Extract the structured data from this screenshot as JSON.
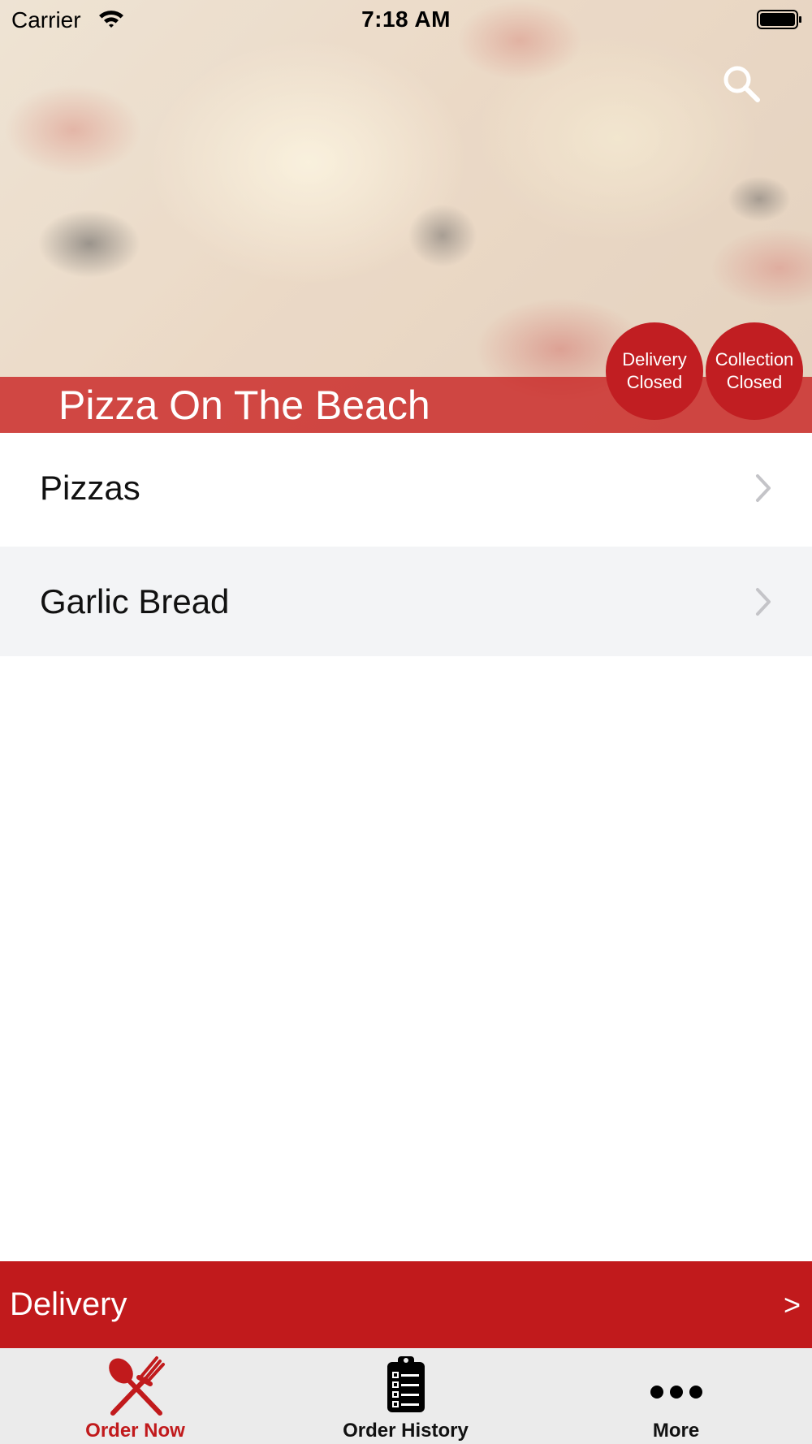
{
  "status_bar": {
    "carrier": "Carrier",
    "time": "7:18 AM",
    "wifi_icon": "wifi-icon",
    "battery_icon": "battery-icon"
  },
  "header": {
    "restaurant_name": "Pizza On The Beach",
    "search_icon": "search-icon",
    "badges": [
      {
        "line1": "Delivery",
        "line2": "Closed"
      },
      {
        "line1": "Collection",
        "line2": "Closed"
      }
    ]
  },
  "categories": [
    {
      "label": "Pizzas"
    },
    {
      "label": "Garlic Bread"
    }
  ],
  "order_mode": {
    "label": "Delivery",
    "arrow": ">"
  },
  "tabs": [
    {
      "label": "Order Now",
      "icon": "fork-knife-icon",
      "active": true
    },
    {
      "label": "Order History",
      "icon": "clipboard-list-icon",
      "active": false
    },
    {
      "label": "More",
      "icon": "more-dots-icon",
      "active": false
    }
  ],
  "colors": {
    "accent": "#c11a1c",
    "tab_bar_bg": "#ebebeb",
    "alt_row_bg": "#f3f4f6"
  }
}
